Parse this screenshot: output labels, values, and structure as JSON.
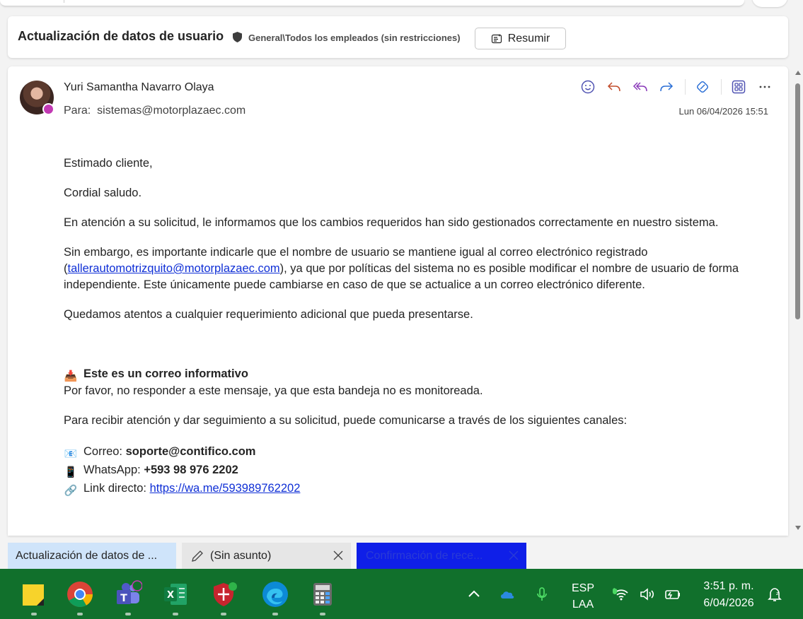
{
  "subject": {
    "title": "Actualización de datos de usuario",
    "sensitivity": "General\\Todos los empleados (sin restricciones)",
    "summarize_label": "Resumir"
  },
  "message": {
    "sender": "Yuri Samantha Navarro Olaya",
    "to_label": "Para:",
    "to": "sistemas@motorplazaec.com",
    "date": "Lun 06/04/2026 15:51",
    "greeting": "Estimado cliente,",
    "salute": "Cordial saludo.",
    "para1": "En atención a su solicitud, le informamos que los cambios requeridos han sido gestionados correctamente en nuestro sistema.",
    "para2_before": "Sin embargo, es importante indicarle que el nombre de usuario se mantiene igual al correo electrónico registrado (",
    "para2_link": "tallerautomotrizquito@motorplazaec.com",
    "para2_after": "), ya que por políticas del sistema no es posible modificar el nombre de usuario de forma independiente. Este únicamente puede cambiarse en caso de que se actualice a un correo electrónico diferente.",
    "para3": "Quedamos atentos a cualquier requerimiento adicional que pueda presentarse.",
    "info_heading": "Este es un correo informativo",
    "info_text": "Por favor, no responder a este mensaje, ya que esta bandeja no es monitoreada.",
    "channels_intro": "Para recibir atención y dar seguimiento a su solicitud, puede comunicarse a través de los siguientes canales:",
    "email_label": "Correo:",
    "email_value": "soporte@contifico.com",
    "whatsapp_label": "WhatsApp:",
    "whatsapp_value": "+593 98 976 2202",
    "link_label": "Link directo:",
    "link_value": "https://wa.me/593989762202"
  },
  "tabs": [
    {
      "label": "Actualización de datos de ..."
    },
    {
      "label": "(Sin asunto)"
    },
    {
      "label": "Confirmación de rece..."
    }
  ],
  "taskbar": {
    "language": "ESP",
    "layout": "LAA",
    "time": "3:51 p. m.",
    "date": "6/04/2026"
  },
  "colors": {
    "accent": "#4f52b2",
    "link": "#0f2fd6",
    "taskbar": "#11702c",
    "active_tab": "#0f1fe8"
  }
}
